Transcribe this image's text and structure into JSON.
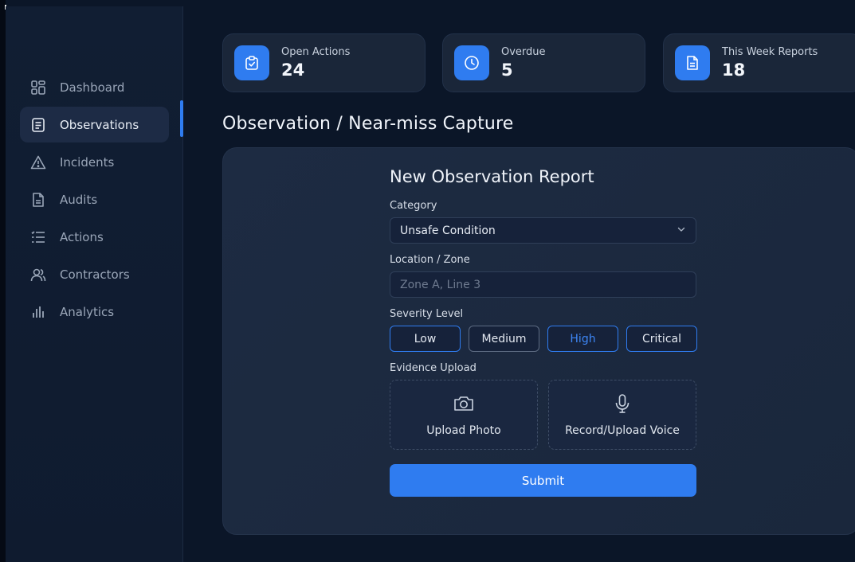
{
  "sidebar": {
    "items": [
      {
        "label": "Dashboard",
        "icon": "dashboard-icon"
      },
      {
        "label": "Observations",
        "icon": "document-icon",
        "active": true
      },
      {
        "label": "Incidents",
        "icon": "warning-icon"
      },
      {
        "label": "Audits",
        "icon": "file-icon"
      },
      {
        "label": "Actions",
        "icon": "list-icon"
      },
      {
        "label": "Contractors",
        "icon": "users-icon"
      },
      {
        "label": "Analytics",
        "icon": "bar-chart-icon"
      }
    ]
  },
  "stats": [
    {
      "label": "Open Actions",
      "value": "24",
      "icon": "clipboard-check-icon"
    },
    {
      "label": "Overdue",
      "value": "5",
      "icon": "clock-icon"
    },
    {
      "label": "This Week Reports",
      "value": "18",
      "icon": "report-icon"
    }
  ],
  "page": {
    "title": "Observation / Near-miss Capture"
  },
  "form": {
    "title": "New Observation Report",
    "category_label": "Category",
    "category_value": "Unsafe Condition",
    "location_label": "Location / Zone",
    "location_placeholder": "Zone A, Line 3",
    "severity_label": "Severity Level",
    "severity_options": [
      "Low",
      "Medium",
      "High",
      "Critical"
    ],
    "severity_selected": "High",
    "evidence_label": "Evidence Upload",
    "upload_photo": "Upload Photo",
    "upload_voice": "Record/Upload Voice",
    "submit": "Submit"
  },
  "colors": {
    "accent": "#2f7cf0",
    "background": "#0b1628",
    "panel": "#1d2b42"
  }
}
